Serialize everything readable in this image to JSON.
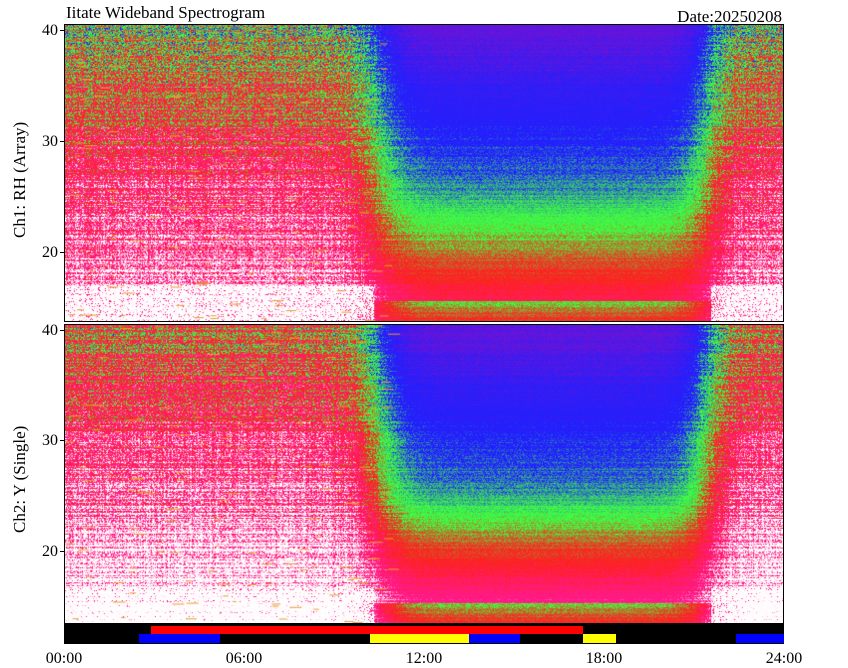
{
  "header": {
    "title": "Iitate Wideband Spectrogram",
    "date": "Date:20250208"
  },
  "colors": {
    "white": "#ffffff",
    "magenta": "#ff1a8c",
    "red": "#ff2020",
    "orange": "#e8a030",
    "green": "#40ff40",
    "blue": "#2020ff",
    "violet": "#6a14d8",
    "black": "#000000",
    "yellow": "#ffff00"
  },
  "chart_data": [
    {
      "type": "heatmap",
      "title": "",
      "ylabel": "Ch1: RH (Array)",
      "xlabel": "",
      "x_range_hours": [
        0,
        24
      ],
      "ylim": [
        12.5,
        40.5
      ],
      "yticks": [
        "20",
        "30",
        "40"
      ]
    },
    {
      "type": "heatmap",
      "title": "",
      "ylabel": "Ch2: Y (Single)",
      "xlabel": "",
      "x_range_hours": [
        0,
        24
      ],
      "ylim": [
        12.5,
        40.5
      ],
      "yticks": [
        "20",
        "30",
        "40"
      ],
      "xticks": [
        "00:00",
        "06:00",
        "12:00",
        "18:00",
        "24:00"
      ]
    }
  ],
  "status_bar": {
    "top_row": [
      {
        "start": 2.9,
        "end": 17.3,
        "color": "#ff0000"
      }
    ],
    "bottom_row": [
      {
        "start": 2.5,
        "end": 5.2,
        "color": "#0000ff"
      },
      {
        "start": 10.2,
        "end": 13.5,
        "color": "#ffff00"
      },
      {
        "start": 13.5,
        "end": 15.2,
        "color": "#0000ff"
      },
      {
        "start": 17.3,
        "end": 18.4,
        "color": "#ffff00"
      },
      {
        "start": 22.4,
        "end": 24.0,
        "color": "#0000ff"
      }
    ]
  }
}
